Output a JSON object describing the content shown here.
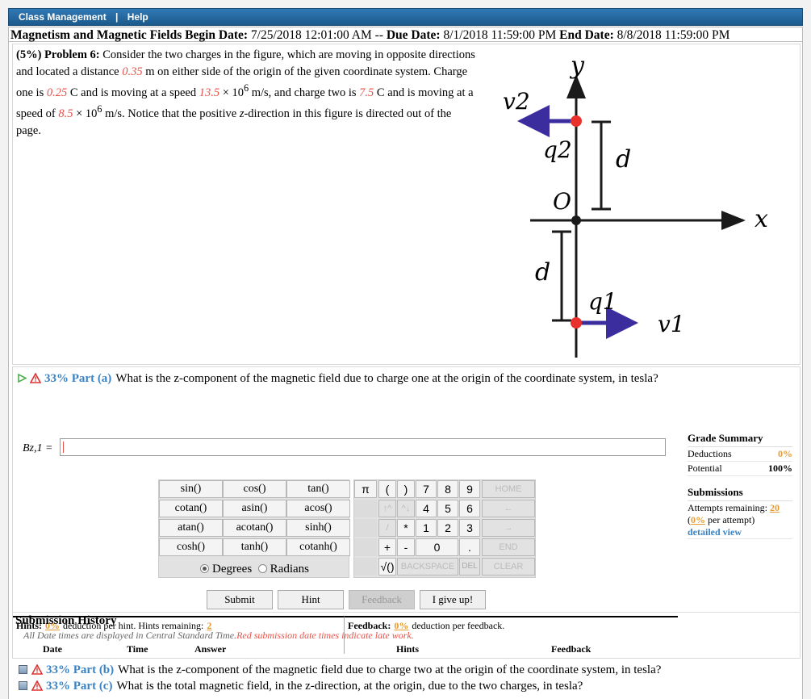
{
  "nav": {
    "class_management": "Class Management",
    "help": "Help"
  },
  "assignment": {
    "name": "Magnetism and Magnetic Fields",
    "begin_label": "Begin Date:",
    "begin_value": "7/25/2018 12:01:00 AM",
    "separator": "--",
    "due_label": "Due Date:",
    "due_value": "8/1/2018 11:59:00 PM",
    "end_label": "End Date:",
    "end_value": "8/8/2018 11:59:00 PM"
  },
  "problem": {
    "weight": "(5%)",
    "title": "Problem 6:",
    "text_1": "Consider the two charges in the figure, which are moving in opposite directions and located a distance",
    "distance": "0.35",
    "text_2": "m on either side of the origin of the given coordinate system. Charge one is",
    "charge_one": "0.25",
    "text_3": "C and is moving at a speed",
    "speed_one": "13.5",
    "text_4": "× 10",
    "exp": "6",
    "text_5": "m/s, and charge two is",
    "charge_two": "7.5",
    "text_6": "C and is moving at a speed of",
    "speed_two": "8.5",
    "text_7": "× 10",
    "text_8": "m/s. Notice that the positive",
    "z_var": "z",
    "text_9": "-direction in this figure is directed out of the page."
  },
  "figure": {
    "y_label": "y",
    "x_label": "x",
    "origin_label": "O",
    "q1_label": "q1",
    "q2_label": "q2",
    "v1_label": "v1",
    "v2_label": "v2",
    "d_label": "d",
    "axis_color": "#1a1a1a",
    "charge_color": "#e8312a",
    "arrow_color": "#3b2d9e"
  },
  "part_a": {
    "percent": "33% Part (a)",
    "question": "What is the z-component of the magnetic field due to charge one at the origin of the coordinate system, in tesla?",
    "answer_label": "Bz,1 =",
    "answer_value": ""
  },
  "calculator": {
    "functions": [
      "sin()",
      "cos()",
      "tan()",
      "cotan()",
      "asin()",
      "acos()",
      "atan()",
      "acotan()",
      "sinh()",
      "cosh()",
      "tanh()",
      "cotanh()"
    ],
    "degrees": "Degrees",
    "radians": "Radians",
    "pi": "π",
    "lparen": "(",
    "rparen": ")",
    "digits": [
      "7",
      "8",
      "9",
      "4",
      "5",
      "6",
      "1",
      "2",
      "3",
      "0"
    ],
    "up_arrow": "↑^",
    "down_arrow": "^↓",
    "slash": "/",
    "star": "*",
    "plus": "+",
    "minus": "-",
    "dot": ".",
    "sqrt": "√()",
    "home": "HOME",
    "left": "←",
    "right": "→",
    "end": "END",
    "backspace": "BACKSPACE",
    "del": "DEL",
    "clear": "CLEAR"
  },
  "actions": {
    "submit": "Submit",
    "hint": "Hint",
    "feedback": "Feedback",
    "give_up": "I give up!"
  },
  "hints": {
    "label": "Hints:",
    "pct": "0%",
    "text": "deduction per hint. Hints remaining:",
    "remaining": "2"
  },
  "feedback": {
    "label": "Feedback:",
    "pct": "0%",
    "text": "deduction per feedback."
  },
  "grade_summary": {
    "title": "Grade Summary",
    "deductions_label": "Deductions",
    "deductions_value": "0%",
    "potential_label": "Potential",
    "potential_value": "100%"
  },
  "submissions": {
    "title": "Submissions",
    "attempts_label": "Attempts remaining:",
    "attempts_value": "20",
    "per_attempt_pct": "0%",
    "per_attempt_text": "per attempt)",
    "open_paren": "(",
    "detailed_view": "detailed view"
  },
  "history": {
    "title": "Submission History",
    "note": "All Date times are displayed in Central Standard Time.",
    "late_note": "Red submission date times indicate late work.",
    "columns": [
      "Date",
      "Time",
      "Answer",
      "Hints",
      "Feedback"
    ]
  },
  "part_b": {
    "percent": "33% Part (b)",
    "question": "What is the z-component of the magnetic field due to charge two at the origin of the coordinate system, in tesla?"
  },
  "part_c": {
    "percent": "33% Part (c)",
    "question": "What is the total magnetic field, in the z-direction, at the origin, due to the two charges, in tesla?"
  }
}
